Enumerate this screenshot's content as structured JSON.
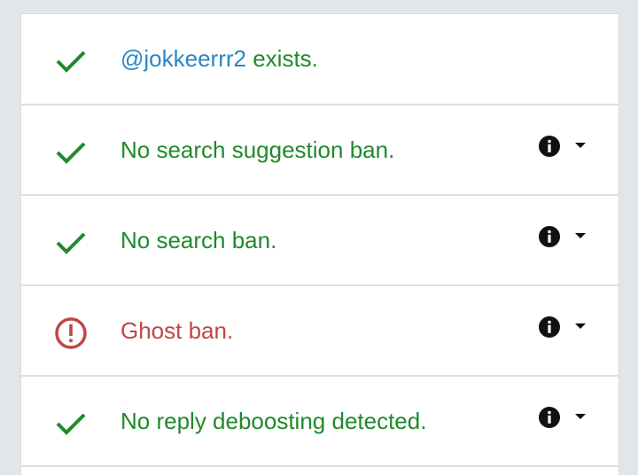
{
  "rows": [
    {
      "icon": "check-icon",
      "handle": "@jokkeerrr2",
      "text": " exists.",
      "status": "ok",
      "has_info": false
    },
    {
      "icon": "check-icon",
      "text": "No search suggestion ban.",
      "status": "ok",
      "has_info": true
    },
    {
      "icon": "check-icon",
      "text": "No search ban.",
      "status": "ok",
      "has_info": true
    },
    {
      "icon": "alert-circle-icon",
      "text": "Ghost ban.",
      "status": "bad",
      "has_info": true
    },
    {
      "icon": "check-icon",
      "text": "No reply deboosting detected.",
      "status": "ok",
      "has_info": true
    }
  ],
  "colors": {
    "ok": "#1f8a2b",
    "bad": "#c04646",
    "handle": "#2b86c5",
    "icon": "#111111"
  }
}
